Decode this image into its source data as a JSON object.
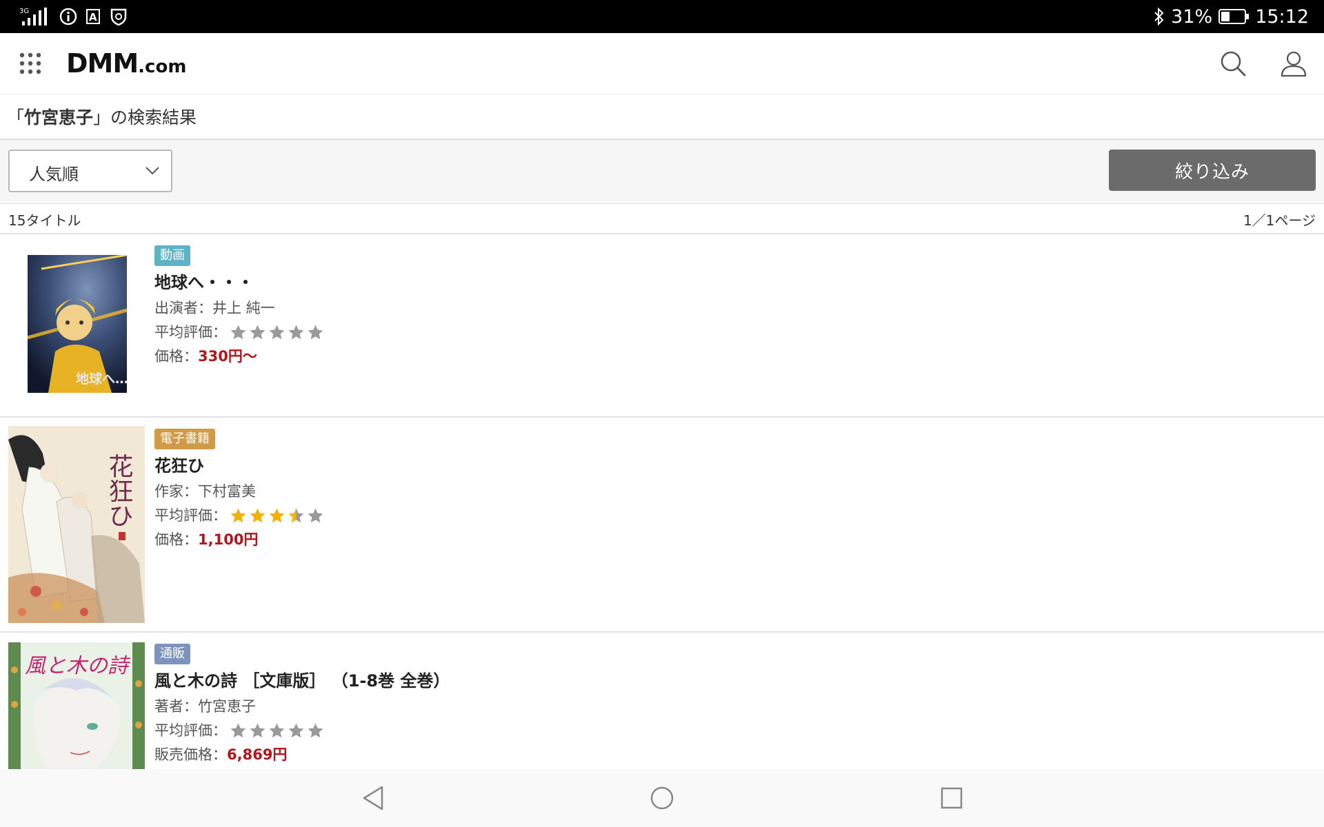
{
  "status_bar": {
    "network": "3G",
    "battery": "31%",
    "time": "15:12"
  },
  "header": {
    "logo_main": "DMM",
    "logo_suffix": ".com"
  },
  "search": {
    "open_quote": "「",
    "query": "竹宮恵子",
    "close_text": "」の検索結果"
  },
  "toolbar": {
    "sort_label": "人気順",
    "filter_label": "絞り込み"
  },
  "results": {
    "count": "15タイトル",
    "page": "1／1ページ"
  },
  "items": [
    {
      "badge": "動画",
      "badge_color": "#5bb3c4",
      "title": "地球へ・・・",
      "person_label": "出演者：",
      "person": "井上 純一",
      "rating_label": "平均評価：",
      "rating": 0,
      "price_label": "価格：",
      "price": "330円〜",
      "cover_text": "地球へ…"
    },
    {
      "badge": "電子書籍",
      "badge_color": "#d09a47",
      "title": "花狂ひ",
      "person_label": "作家：",
      "person": "下村富美",
      "rating_label": "平均評価：",
      "rating": 3.5,
      "price_label": "価格：",
      "price": "1,100円",
      "cover_text": "花狂ひ"
    },
    {
      "badge": "通販",
      "badge_color": "#7d92bd",
      "title": "風と木の詩 ［文庫版］ （1-8巻 全巻）",
      "person_label": "著者：",
      "person": "竹宮恵子",
      "rating_label": "平均評価：",
      "rating": 0,
      "price_label": "販売価格：",
      "price": "6,869円",
      "cover_text": "風と木の詩"
    }
  ],
  "colors": {
    "price": "#b3151a",
    "star_on": "#f2b20c",
    "star_off": "#9a9a9a"
  }
}
